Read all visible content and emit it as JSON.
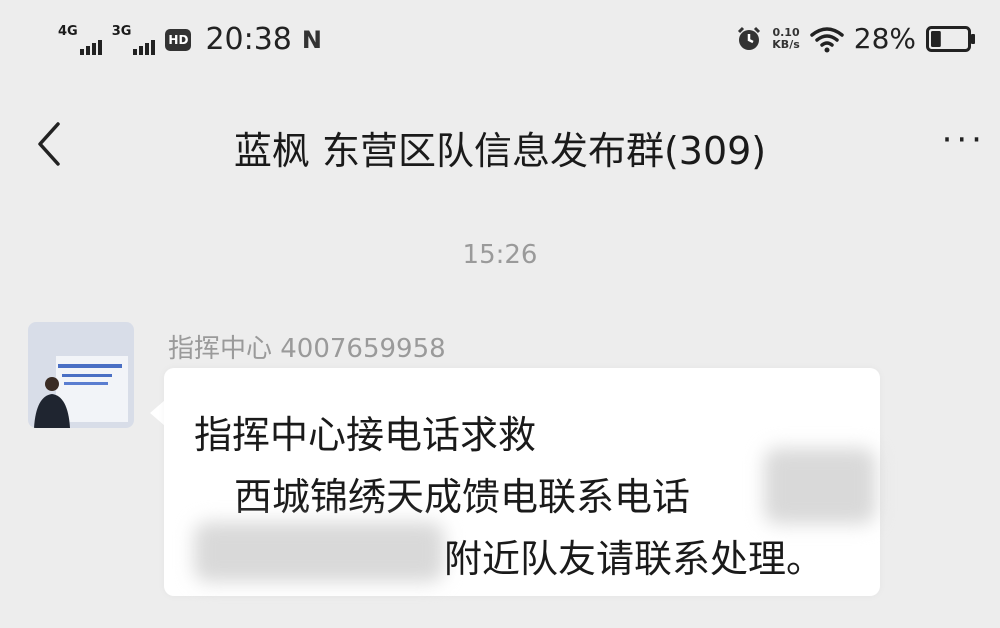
{
  "status_bar": {
    "network1": "4G",
    "network2": "3G",
    "hd_badge": "HD",
    "time": "20:38",
    "nfc_icon": "N",
    "speed_value": "0.10",
    "speed_unit": "KB/s",
    "battery_percent": "28%",
    "battery_level": 0.28,
    "icons": [
      "signal-icon",
      "hd-icon",
      "nfc-icon",
      "alarm-icon",
      "wifi-icon",
      "battery-icon"
    ]
  },
  "header": {
    "title": "蓝枫 东营区队信息发布群(309)",
    "back_icon": "chevron-left-icon",
    "more_label": "···"
  },
  "chat": {
    "timestamp": "15:26",
    "message": {
      "sender": "指挥中心 4007659958",
      "line1": "指挥中心接电话求救",
      "line2": "西城锦绣天成馈电联系电话",
      "line3": "附近队友请联系处理。"
    }
  },
  "colors": {
    "background": "#ededed",
    "bubble": "#ffffff",
    "meta_text": "#9a9a9a"
  }
}
